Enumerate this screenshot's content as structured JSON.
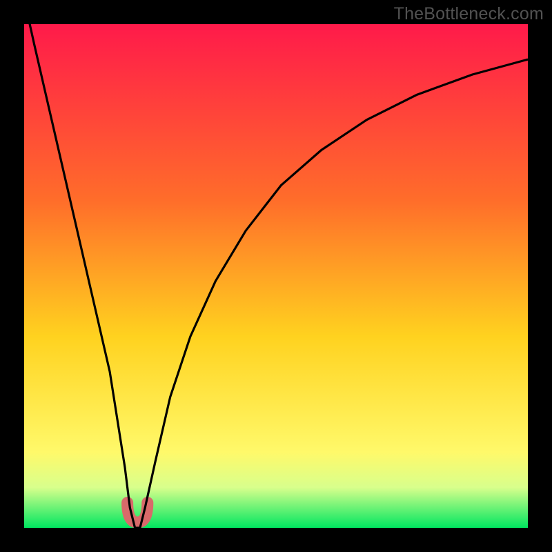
{
  "attribution": "TheBottleneck.com",
  "colors": {
    "frame": "#000000",
    "gradient_top": "#ff1a4a",
    "gradient_mid1": "#ff6d2a",
    "gradient_mid2": "#ffd21f",
    "gradient_mid3": "#fff96a",
    "gradient_bottom": "#00e660",
    "curve": "#000000",
    "highlight": "#d86a6a"
  },
  "chart_data": {
    "type": "line",
    "title": "",
    "xlabel": "",
    "ylabel": "",
    "xlim": [
      0,
      100
    ],
    "ylim": [
      0,
      100
    ],
    "grid": false,
    "series": [
      {
        "name": "bottleneck-curve",
        "x": [
          0,
          2,
          5,
          8,
          11,
          14,
          17,
          20,
          21,
          22,
          22.5,
          23,
          24,
          26,
          29,
          33,
          38,
          44,
          51,
          59,
          68,
          78,
          89,
          100
        ],
        "values": [
          105,
          96,
          83,
          70,
          57,
          44,
          31,
          12,
          4,
          0,
          0,
          0,
          4,
          13,
          26,
          38,
          49,
          59,
          68,
          75,
          81,
          86,
          90,
          93
        ]
      }
    ],
    "highlight": {
      "name": "optimal-zone",
      "x_range": [
        20.5,
        24.5
      ],
      "y_range": [
        0,
        5
      ],
      "shape": "u"
    }
  }
}
